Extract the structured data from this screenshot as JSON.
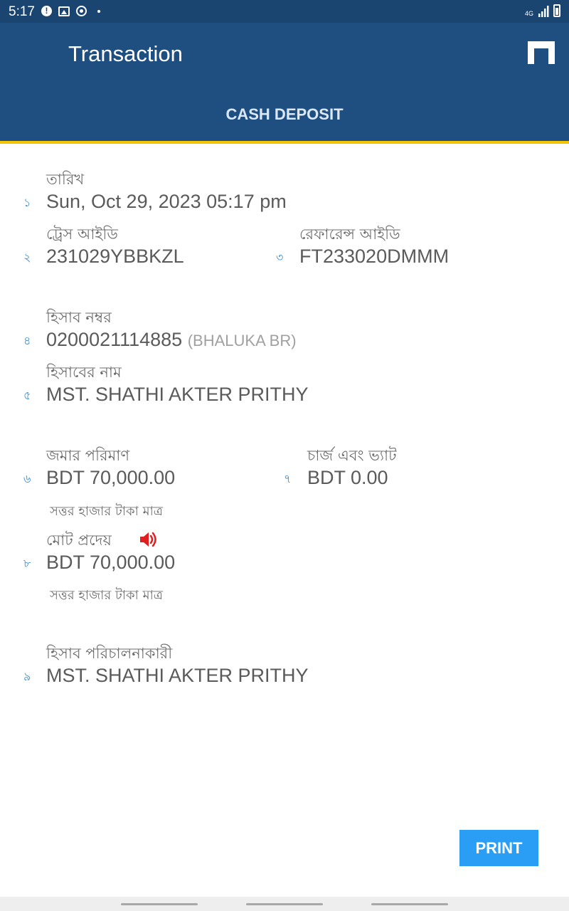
{
  "status_bar": {
    "time": "5:17",
    "network": "4G",
    "icons": [
      "alert-icon",
      "image-icon",
      "sync-icon",
      "dot-icon",
      "signal-icon",
      "battery-icon"
    ]
  },
  "app_bar": {
    "title": "Transaction",
    "tab": "CASH DEPOSIT",
    "home_icon": "home-icon"
  },
  "colors": {
    "status_bar": "#1b4571",
    "app_bar": "#1f4f80",
    "accent": "#f5c400",
    "row_number": "#3a8fd2",
    "speaker": "#e02020",
    "print_button": "#2a9df4"
  },
  "fields": {
    "date": {
      "num": "১",
      "label": "তারিখ",
      "value": "Sun, Oct 29, 2023 05:17 pm"
    },
    "trace_id": {
      "num": "২",
      "label": "ট্রেস আইডি",
      "value": "231029YBBKZL"
    },
    "reference_id": {
      "num": "৩",
      "label": "রেফারেন্স আইডি",
      "value": "FT233020DMMM"
    },
    "account_number": {
      "num": "৪",
      "label": "হিসাব নম্বর",
      "value": "0200021114885",
      "branch": "(BHALUKA BR)"
    },
    "account_name": {
      "num": "৫",
      "label": "হিসাবের নাম",
      "value": "MST. SHATHI AKTER PRITHY"
    },
    "deposit_amount": {
      "num": "৬",
      "label": "জমার পরিমাণ",
      "value": "BDT 70,000.00",
      "words": "সত্তর হাজার টাকা মাত্র"
    },
    "charge_vat": {
      "num": "৭",
      "label": "চার্জ এবং ভ্যাট",
      "value": "BDT 0.00"
    },
    "total_payable": {
      "num": "৮",
      "label": "মোট প্রদেয়",
      "value": "BDT 70,000.00",
      "words": "সত্তর হাজার টাকা মাত্র"
    },
    "account_operator": {
      "num": "৯",
      "label": "হিসাব পরিচালনাকারী",
      "value": "MST. SHATHI AKTER PRITHY"
    }
  },
  "actions": {
    "print_label": "PRINT"
  }
}
